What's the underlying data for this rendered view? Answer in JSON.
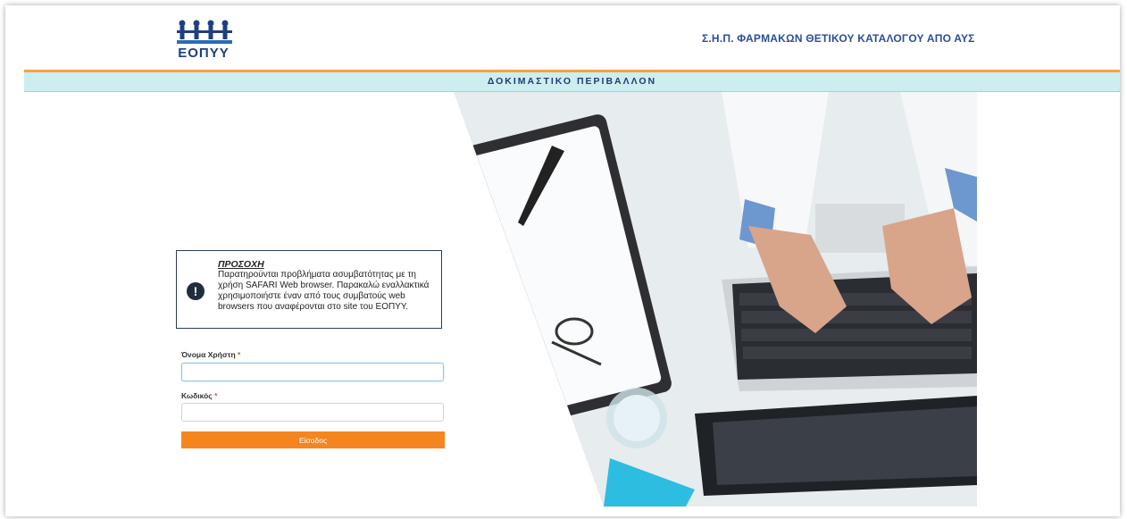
{
  "header": {
    "logo_text": "ΕΟΠΥΥ",
    "title": "Σ.Η.Π. ΦΑΡΜΑΚΩΝ ΘΕΤΙΚΟΥ ΚΑΤΑΛΟΓΟΥ ΑΠΟ ΑΥΣ"
  },
  "environment_banner": "ΔΟΚΙΜΑΣΤΙΚΟ ΠΕΡΙΒΑΛΛΟΝ",
  "warning": {
    "icon": "exclamation-icon",
    "title": "ΠΡΟΣΟΧΗ",
    "message": "Παρατηρούνται προβλήματα ασυμβατότητας με τη χρήση SAFARI Web browser. Παρακαλώ εναλλακτικά χρησιμοποιήστε έναν από τους συμβατούς web browsers που αναφέρονται στο site του ΕΟΠΥΥ."
  },
  "form": {
    "username_label": "Όνομα Χρήστη",
    "username_value": "",
    "password_label": "Κωδικός",
    "password_value": "",
    "required_mark": "*",
    "submit_label": "Είσοδος"
  },
  "colors": {
    "accent": "#f5861f",
    "banner_bg": "#cdeef0",
    "title_blue": "#2b4f9a"
  }
}
